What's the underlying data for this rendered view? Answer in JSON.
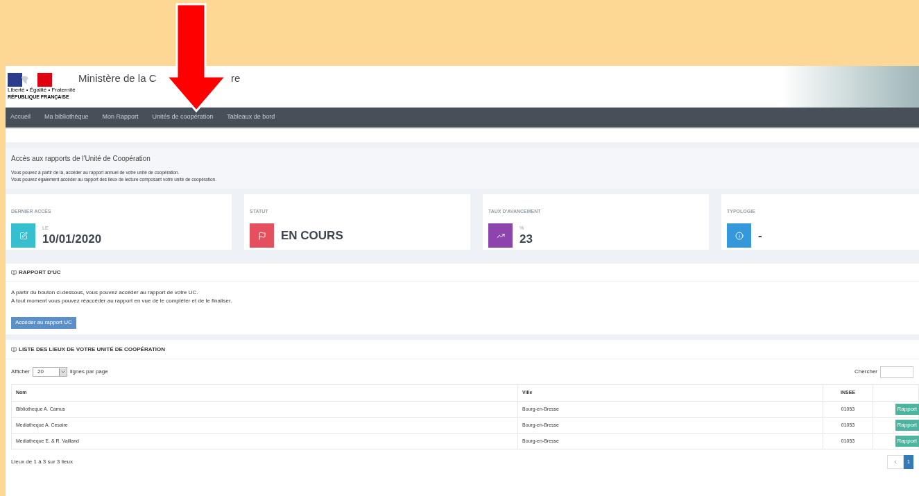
{
  "logo": {
    "motto": "Liberté • Égalité • Fraternité",
    "name": "RÉPUBLIQUE FRANÇAISE"
  },
  "site_title": {
    "parts": [
      "Ministère de la C",
      "re"
    ]
  },
  "nav": [
    "Accueil",
    "Ma bibliothèque",
    "Mon Rapport",
    "Unités de coopération",
    "Tableaux de bord"
  ],
  "intro": {
    "title": "Accès aux rapports de l'Unité de Coopération",
    "lines": [
      "Vous pouvez à partir de là, accéder au rapport annuel de votre unité de coopération.",
      "Vous pouvez également accéder au rapport des lieux de lecture composant votre unité de coopération."
    ]
  },
  "stats": [
    {
      "label": "DERNIER ACCÈS",
      "sub": "LE",
      "value": "10/01/2020",
      "kind": "edit",
      "color": "#35bfcf"
    },
    {
      "label": "STATUT",
      "value": "EN COURS",
      "kind": "flag",
      "color": "#e5505f"
    },
    {
      "label": "TAUX D'AVANCEMENT",
      "sub": "%",
      "value": "23",
      "kind": "trend",
      "color": "#8e44ad"
    },
    {
      "label": "TYPOLOGIE",
      "value": "-",
      "kind": "info",
      "color": "#3498db"
    }
  ],
  "rapport": {
    "title": "RAPPORT D'UC",
    "lines": [
      "A partir du bouton ci-dessous, vous pouvez accéder au rapport de votre UC.",
      "A tout moment vous pouvez réaccéder au rapport en vue de le compléter et de le finaliser."
    ],
    "button": "Accéder au rapport UC"
  },
  "liste": {
    "title": "LISTE DES LIEUX DE VOTRE UNITÉ DE COOPÉRATION",
    "show_label": "Afficher",
    "page_size": "20",
    "per_page_label": "lignes par page",
    "search_label": "Chercher",
    "columns": [
      "Nom",
      "Ville",
      "INSEE"
    ],
    "rows": [
      {
        "nom": "Bibliotheque A. Camus",
        "ville": "Bourg-en-Bresse",
        "insee": "01053",
        "action": "Rapport"
      },
      {
        "nom": "Mediatheque A. Cesaire",
        "ville": "Bourg-en-Bresse",
        "insee": "01053",
        "action": "Rapport"
      },
      {
        "nom": "Mediatheque E. & R. Vailland",
        "ville": "Bourg-en-Bresse",
        "insee": "01053",
        "action": "Rapport"
      }
    ],
    "summary": "Lieux de 1 à 3 sur 3 lieux",
    "pages": [
      {
        "label": "1",
        "selected": true
      }
    ]
  }
}
